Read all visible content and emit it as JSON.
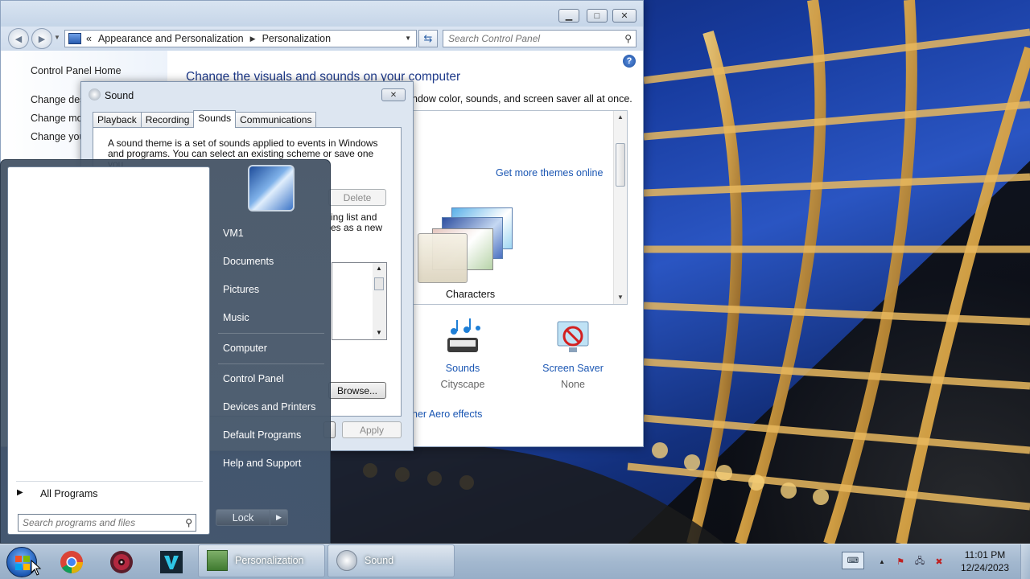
{
  "control_panel": {
    "breadcrumb_prefix": "«",
    "breadcrumb": [
      "Appearance and Personalization",
      "Personalization"
    ],
    "search_placeholder": "Search Control Panel",
    "left_links": [
      "Control Panel Home",
      "Change des",
      "Change mo",
      "Change you"
    ],
    "heading": "Change the visuals and sounds on your computer",
    "subheading_partial": "ndow color, sounds, and screen saver all at once.",
    "get_more_themes": "Get more themes online",
    "theme_name": "Characters",
    "sounds_label": "Sounds",
    "sounds_value": "Cityscape",
    "screensaver_label": "Screen Saver",
    "screensaver_value": "None",
    "aero_link_partial": "her Aero effects"
  },
  "sound_dialog": {
    "title": "Sound",
    "tabs": [
      "Playback",
      "Recording",
      "Sounds",
      "Communications"
    ],
    "active_tab": "Sounds",
    "description": "A sound theme is a set of sounds applied to events in Windows and programs.  You can select an existing scheme or save one you",
    "delete_label": "Delete",
    "partial_line1": "ing list and",
    "partial_line2": "es as a new",
    "browse_label": "Browse...",
    "apply_label": "Apply"
  },
  "start_menu": {
    "right_items": [
      "VM1",
      "Documents",
      "Pictures",
      "Music",
      "Computer",
      "Control Panel",
      "Devices and Printers",
      "Default Programs",
      "Help and Support"
    ],
    "all_programs": "All Programs",
    "search_placeholder": "Search programs and files",
    "lock_label": "Lock"
  },
  "taskbar": {
    "tasks": [
      "Personalization",
      "Sound"
    ],
    "time": "11:01 PM",
    "date": "12/24/2023",
    "pinned_icons": [
      "chrome-icon",
      "media-player-icon",
      "vegas-icon"
    ]
  }
}
